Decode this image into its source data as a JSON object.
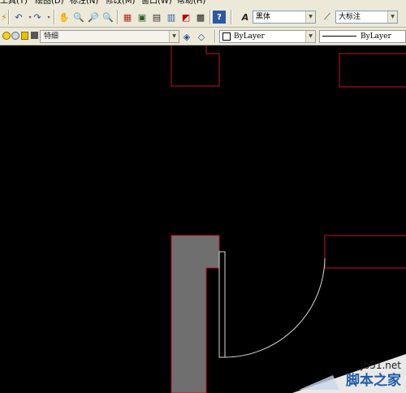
{
  "menu": {
    "items": [
      "工具(T)",
      "绘图(D)",
      "标注(N)",
      "修改(M)",
      "窗口(W)",
      "帮助(H)"
    ]
  },
  "toolbar": {
    "text_style": "黑体",
    "dim_style": "大标注",
    "layer": "特细",
    "color": "ByLayer",
    "linetype": "ByLayer"
  },
  "colors": {
    "wall_outline": "#c8102e",
    "fill": "#6f6f6f",
    "door": "#d8d8d8",
    "watermark_text": "#1e5aa8"
  },
  "icons": [
    "pan-icon",
    "zoom-realtime-icon",
    "zoom-window-icon",
    "zoom-previous-icon",
    "properties-icon",
    "design-center-icon",
    "tool-palettes-icon",
    "sheet-set-icon",
    "markup-icon",
    "calculator-icon",
    "help-icon",
    "text-style-icon",
    "dim-style-icon",
    "layer-state-icon",
    "make-current-icon",
    "layer-previous-icon"
  ],
  "watermark": {
    "url": "jb51.net",
    "site": "脚本之家"
  }
}
